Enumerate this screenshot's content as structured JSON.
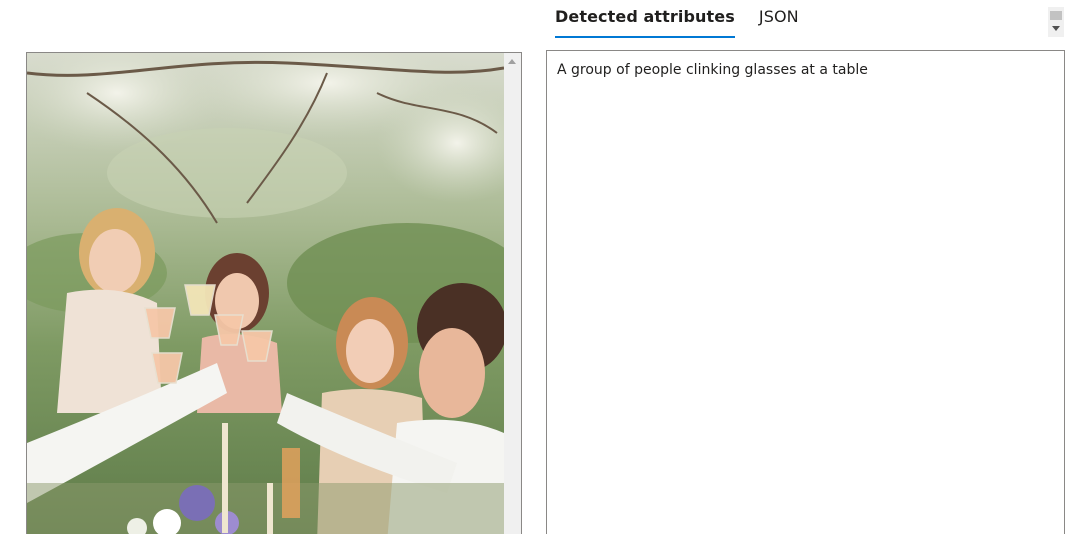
{
  "tabs": [
    {
      "label": "Detected attributes",
      "active": true
    },
    {
      "label": "JSON",
      "active": false
    }
  ],
  "result": {
    "caption": "A group of people clinking glasses at a table"
  },
  "image": {
    "icon": "photo-image",
    "scene": "outdoor party toast"
  },
  "colors": {
    "accent": "#0078d4",
    "border": "#8a8886",
    "scrollbar": "#f0f0f0"
  }
}
